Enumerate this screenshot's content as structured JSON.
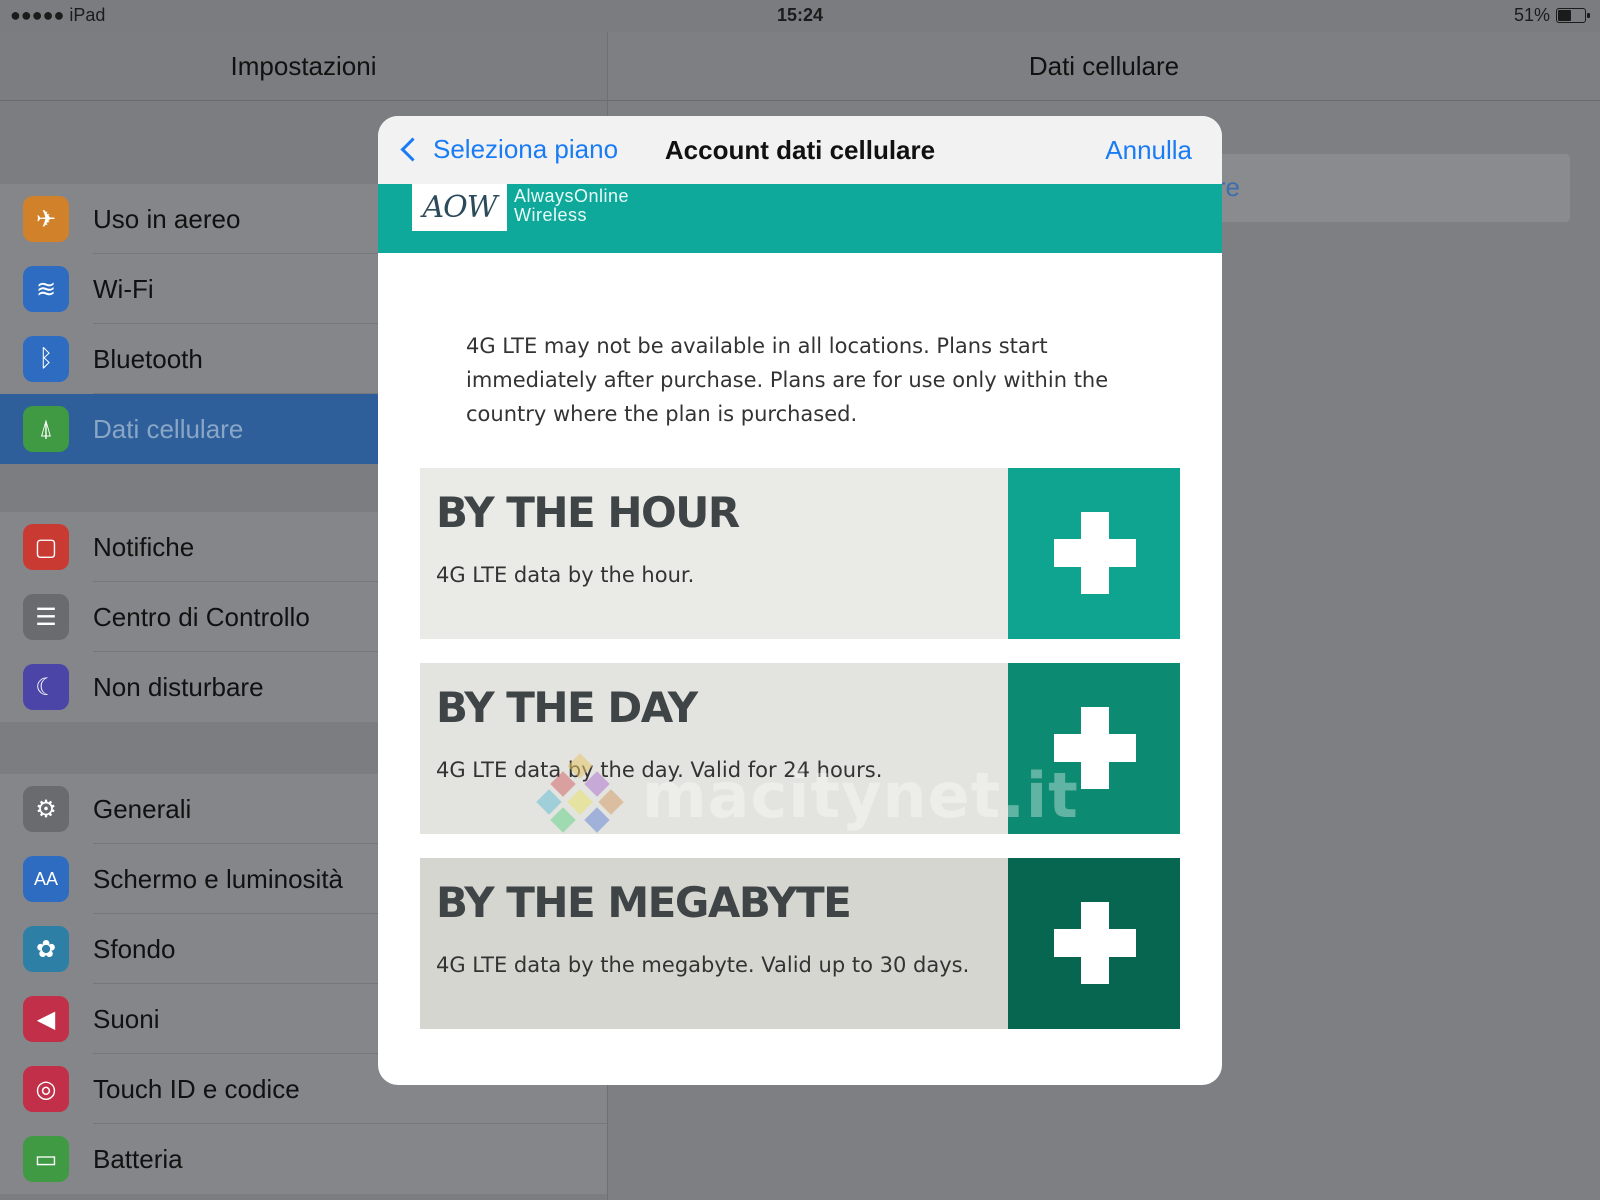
{
  "status_bar": {
    "carrier": "●●●●● iPad",
    "time": "15:24",
    "battery_percent": "51%",
    "battery_level": 0.51
  },
  "left_pane": {
    "title": "Impostazioni",
    "groups": [
      [
        {
          "label": "Uso in aereo",
          "icon": "airplane-icon",
          "color": "#d1812a",
          "selected": false
        },
        {
          "label": "Wi-Fi",
          "icon": "wifi-icon",
          "color": "#2d6cc0",
          "selected": false
        },
        {
          "label": "Bluetooth",
          "icon": "bluetooth-icon",
          "color": "#2d6cc0",
          "selected": false
        },
        {
          "label": "Dati cellulare",
          "icon": "cellular-antenna-icon",
          "color": "#3f9a43",
          "selected": true
        }
      ],
      [
        {
          "label": "Notifiche",
          "icon": "notifications-icon",
          "color": "#c93a33",
          "selected": false
        },
        {
          "label": "Centro di Controllo",
          "icon": "control-center-icon",
          "color": "#6a6b6f",
          "selected": false
        },
        {
          "label": "Non disturbare",
          "icon": "moon-icon",
          "color": "#4b45a8",
          "selected": false
        }
      ],
      [
        {
          "label": "Generali",
          "icon": "gear-icon",
          "color": "#6a6b6f",
          "selected": false
        },
        {
          "label": "Schermo e luminosità",
          "icon": "display-brightness-icon",
          "color": "#2d6cc0",
          "selected": false
        },
        {
          "label": "Sfondo",
          "icon": "wallpaper-flower-icon",
          "color": "#2e7fa6",
          "selected": false
        },
        {
          "label": "Suoni",
          "icon": "speaker-icon",
          "color": "#c12f48",
          "selected": false
        },
        {
          "label": "Touch ID e codice",
          "icon": "fingerprint-icon",
          "color": "#c12f48",
          "selected": false
        },
        {
          "label": "Batteria",
          "icon": "battery-icon",
          "color": "#3f9a43",
          "selected": false
        }
      ]
    ]
  },
  "right_pane": {
    "title": "Dati cellulare",
    "cell_text_fragment": "re"
  },
  "modal": {
    "back_label": "Seleziona piano",
    "title": "Account dati cellulare",
    "cancel_label": "Annulla",
    "brand": {
      "logo_text": "AOW",
      "name_line1": "AlwaysOnline",
      "name_line2": "Wireless",
      "color": "#0ea99a"
    },
    "notice": "4G LTE may not be available in all locations. Plans start immediately after purchase. Plans are for use only within the country where the plan is purchased.",
    "plans": [
      {
        "name": "BY THE HOUR",
        "description": "4G LTE data by the hour.",
        "bg": "#eaeae6",
        "accent": "#0fa48f"
      },
      {
        "name": "BY THE DAY",
        "description": "4G LTE data by the day. Valid for 24 hours.",
        "bg": "#e3e3df",
        "accent": "#0d8a72"
      },
      {
        "name": "BY THE MEGABYTE",
        "description": "4G LTE data by the megabyte. Valid up to 30 days.",
        "bg": "#d6d6d1",
        "accent": "#07664f"
      }
    ]
  },
  "watermark": "macitynet.it"
}
